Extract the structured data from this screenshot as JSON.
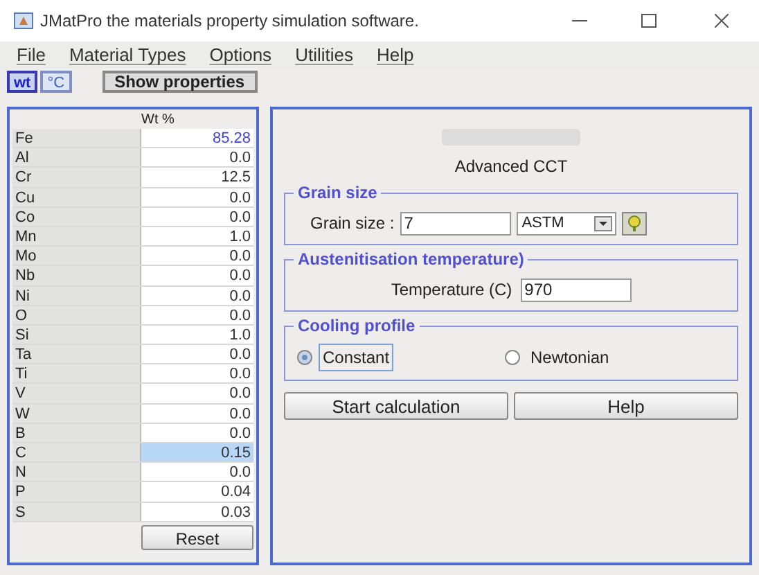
{
  "window": {
    "title": "JMatPro the materials property simulation software."
  },
  "menu": [
    "File",
    "Material Types",
    "Options",
    "Utilities",
    "Help"
  ],
  "toolbar": {
    "units": [
      {
        "label": "wt",
        "selected": true
      },
      {
        "label": "°C",
        "selected": false
      }
    ],
    "show_button": "Show properties"
  },
  "composition": {
    "header": "Wt %",
    "rows": [
      {
        "element": "Fe",
        "value": "85.28",
        "balance": true,
        "selected": false
      },
      {
        "element": "Al",
        "value": "0.0",
        "balance": false,
        "selected": false
      },
      {
        "element": "Cr",
        "value": "12.5",
        "balance": false,
        "selected": false
      },
      {
        "element": "Cu",
        "value": "0.0",
        "balance": false,
        "selected": false
      },
      {
        "element": "Co",
        "value": "0.0",
        "balance": false,
        "selected": false
      },
      {
        "element": "Mn",
        "value": "1.0",
        "balance": false,
        "selected": false
      },
      {
        "element": "Mo",
        "value": "0.0",
        "balance": false,
        "selected": false
      },
      {
        "element": "Nb",
        "value": "0.0",
        "balance": false,
        "selected": false
      },
      {
        "element": "Ni",
        "value": "0.0",
        "balance": false,
        "selected": false
      },
      {
        "element": "O",
        "value": "0.0",
        "balance": false,
        "selected": false
      },
      {
        "element": "Si",
        "value": "1.0",
        "balance": false,
        "selected": false
      },
      {
        "element": "Ta",
        "value": "0.0",
        "balance": false,
        "selected": false
      },
      {
        "element": "Ti",
        "value": "0.0",
        "balance": false,
        "selected": false
      },
      {
        "element": "V",
        "value": "0.0",
        "balance": false,
        "selected": false
      },
      {
        "element": "W",
        "value": "0.0",
        "balance": false,
        "selected": false
      },
      {
        "element": "B",
        "value": "0.0",
        "balance": false,
        "selected": false
      },
      {
        "element": "C",
        "value": "0.15",
        "balance": false,
        "selected": true
      },
      {
        "element": "N",
        "value": "0.0",
        "balance": false,
        "selected": false
      },
      {
        "element": "P",
        "value": "0.04",
        "balance": false,
        "selected": false
      },
      {
        "element": "S",
        "value": "0.03",
        "balance": false,
        "selected": false
      }
    ],
    "reset_button": "Reset"
  },
  "panel": {
    "heading": "Advanced CCT",
    "grain_size": {
      "title": "Grain size",
      "label": "Grain size :",
      "value": "7",
      "unit": "ASTM"
    },
    "austenitisation": {
      "title": "Austenitisation temperature)",
      "label": "Temperature (C)",
      "value": "970"
    },
    "cooling": {
      "title": "Cooling profile",
      "options": [
        {
          "label": "Constant",
          "selected": true
        },
        {
          "label": "Newtonian",
          "selected": false
        }
      ]
    },
    "buttons": [
      "Start calculation",
      "Help"
    ]
  }
}
